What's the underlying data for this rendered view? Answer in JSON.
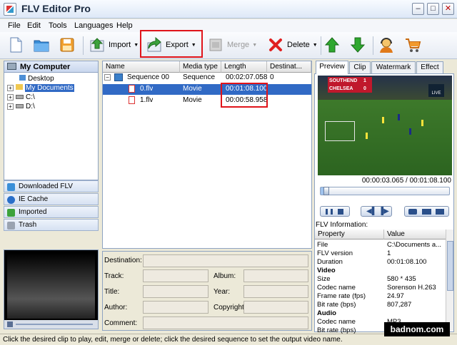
{
  "app": {
    "title": "FLV Editor Pro"
  },
  "menu": [
    "File",
    "Edit",
    "Tools",
    "Languages",
    "Help"
  ],
  "toolbar": {
    "import_label": "Import",
    "export_label": "Export",
    "merge_label": "Merge",
    "delete_label": "Delete"
  },
  "tree": {
    "header": "My Computer",
    "items": [
      "Desktop",
      "My Documents",
      "C:\\",
      "D:\\"
    ]
  },
  "nav": [
    "Downloaded FLV",
    "IE Cache",
    "Imported",
    "Trash"
  ],
  "grid": {
    "columns": [
      "Name",
      "Media type",
      "Length",
      "Destinat..."
    ],
    "rows": [
      {
        "name": "Sequence 00",
        "type": "Sequence",
        "length": "00:02:07.058",
        "dest": "0"
      },
      {
        "name": "0.flv",
        "type": "Movie",
        "length": "00:01:08.100",
        "dest": ""
      },
      {
        "name": "1.flv",
        "type": "Movie",
        "length": "00:00:58.958",
        "dest": ""
      }
    ]
  },
  "form": {
    "destination": "Destination:",
    "track": "Track:",
    "album": "Album:",
    "title": "Title:",
    "year": "Year:",
    "author": "Author:",
    "copyright": "Copyright:",
    "comment": "Comment:"
  },
  "tabs": [
    "Preview",
    "Clip",
    "Watermark",
    "Effect"
  ],
  "preview": {
    "overlay_line1": "SOUTHEND",
    "overlay_line2": "CHELSEA",
    "score1": "1",
    "score2": "0",
    "overlay_badge": "LIVE",
    "time_readout": "00:00:03.065 / 00:01:08.100",
    "progress": 0.045
  },
  "flv_info": {
    "label": "FLV Information:",
    "columns": [
      "Property",
      "Value"
    ],
    "rows": [
      {
        "p": "File",
        "v": "C:\\Documents a..."
      },
      {
        "p": "FLV version",
        "v": "1"
      },
      {
        "p": "Duration",
        "v": "00:01:08.100"
      },
      {
        "p": "Video",
        "v": "",
        "group": true
      },
      {
        "p": "Size",
        "v": "580 * 435"
      },
      {
        "p": "Codec name",
        "v": "Sorenson H.263"
      },
      {
        "p": "Frame rate (fps)",
        "v": "24.97"
      },
      {
        "p": "Bit rate (bps)",
        "v": "807,287"
      },
      {
        "p": "Audio",
        "v": "",
        "group": true
      },
      {
        "p": "Codec name",
        "v": "MP3"
      },
      {
        "p": "Bit rate (bps)",
        "v": ""
      }
    ]
  },
  "status": "Click the desired clip to play, edit, merge or delete; click the desired sequence to set the output video name.",
  "watermark": "badnom.com",
  "colors": {
    "highlight": "#e0141a",
    "selection": "#316ac5"
  }
}
